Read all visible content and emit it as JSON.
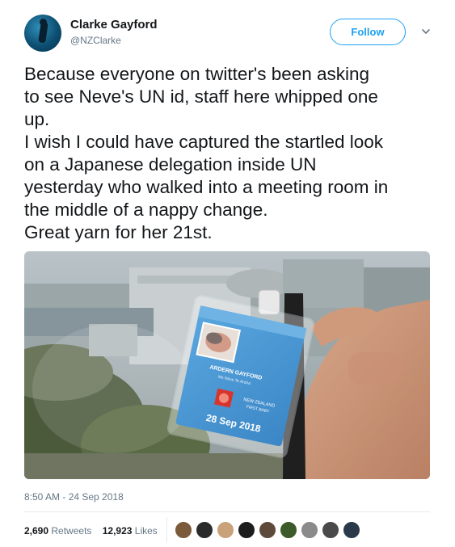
{
  "author": {
    "name": "Clarke Gayford",
    "handle": "@NZClarke",
    "avatar_icon": "profile-avatar"
  },
  "follow_label": "Follow",
  "menu_icon": "chevron-down-icon",
  "tweet_lines": [
    "Because everyone on twitter's been asking",
    "to see Neve's UN id, staff here whipped one",
    "up.",
    "I wish I could have captured the startled look",
    "on a Japanese delegation inside UN",
    "yesterday who walked into a meeting room in",
    "the middle of a nappy change.",
    "Great yarn for her 21st."
  ],
  "badge": {
    "line1": "ARDERN GAYFORD",
    "line2": "Ms Neve Te Aroha",
    "line3": "NEW ZEALAND",
    "line4": "FIRST BABY",
    "date": "28 Sep 2018"
  },
  "timestamp": "8:50 AM - 24 Sep 2018",
  "stats": {
    "retweets_count": "2,690",
    "retweets_label": "Retweets",
    "likes_count": "12,923",
    "likes_label": "Likes"
  },
  "liker_colors": [
    "#7a5a3a",
    "#2b2b2b",
    "#c9a27a",
    "#1d1d1d",
    "#5e4a3a",
    "#3c5a2a",
    "#8a8a8a",
    "#4a4a4a",
    "#2a3a4a"
  ],
  "colors": {
    "accent": "#1da1f2",
    "text": "#14171a",
    "muted": "#657786"
  }
}
